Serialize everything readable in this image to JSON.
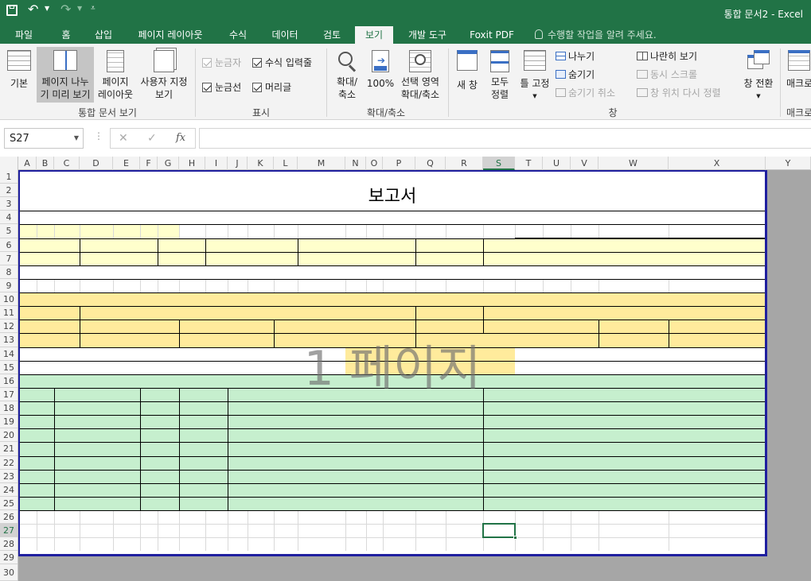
{
  "app": {
    "title": "통합 문서2 - Excel"
  },
  "qat": {
    "save_icon": "save-icon",
    "undo_icon": "undo-icon",
    "redo_icon": "redo-icon",
    "customize_icon": "customize-icon"
  },
  "tabs": [
    "파일",
    "홈",
    "삽입",
    "페이지 레이아웃",
    "수식",
    "데이터",
    "검토",
    "보기",
    "개발 도구",
    "Foxit PDF"
  ],
  "tell_me": "수행할 작업을 알려 주세요.",
  "ribbon": {
    "workbook_views": {
      "normal": "기본",
      "page_break_line1": "페이지 나누",
      "page_break_line2": "기 미리 보기",
      "page_layout_line1": "페이지",
      "page_layout_line2": "레이아웃",
      "custom_line1": "사용자 지정",
      "custom_line2": "보기",
      "group": "통합 문서 보기"
    },
    "show": {
      "ruler": "눈금자",
      "formula_bar": "수식 입력줄",
      "gridlines": "눈금선",
      "headings": "머리글",
      "group": "표시"
    },
    "zoom": {
      "zoom_line1": "확대/",
      "zoom_line2": "축소",
      "hundred": "100%",
      "selection_line1": "선택 영역",
      "selection_line2": "확대/축소",
      "group": "확대/축소"
    },
    "window": {
      "new_window": "새 창",
      "arrange_line1": "모두",
      "arrange_line2": "정렬",
      "freeze": "틀 고정",
      "split": "나누기",
      "hide": "숨기기",
      "unhide": "숨기기 취소",
      "side_by_side": "나란히 보기",
      "sync_scroll": "동시 스크롤",
      "reset_position": "창 위치 다시 정렬",
      "switch": "창 전환",
      "group": "창"
    },
    "macros": {
      "label": "매크로",
      "group": "매크로"
    }
  },
  "formula_bar": {
    "name_box": "S27",
    "cancel": "✕",
    "enter": "✓",
    "fx": "fx",
    "value": ""
  },
  "columns": [
    "A",
    "B",
    "C",
    "D",
    "E",
    "F",
    "G",
    "H",
    "I",
    "J",
    "K",
    "L",
    "M",
    "N",
    "O",
    "P",
    "Q",
    "R",
    "S",
    "T",
    "U",
    "V",
    "W",
    "X",
    "Y"
  ],
  "rows": [
    "1",
    "2",
    "3",
    "4",
    "5",
    "6",
    "7",
    "8",
    "9",
    "10",
    "11",
    "12",
    "13",
    "14",
    "15",
    "16",
    "17",
    "18",
    "19",
    "20",
    "21",
    "22",
    "23",
    "24",
    "25",
    "26",
    "27",
    "28",
    "29",
    "30"
  ],
  "selected": {
    "column": "S",
    "row": "27"
  },
  "sheet": {
    "title": "보고서",
    "page_watermark": "1 페이지"
  },
  "colors": {
    "accent": "#217346",
    "yellow_light": "#ffffcc",
    "yellow": "#ffeb9c",
    "green": "#c6efce",
    "page_border": "#1f1f9f"
  }
}
